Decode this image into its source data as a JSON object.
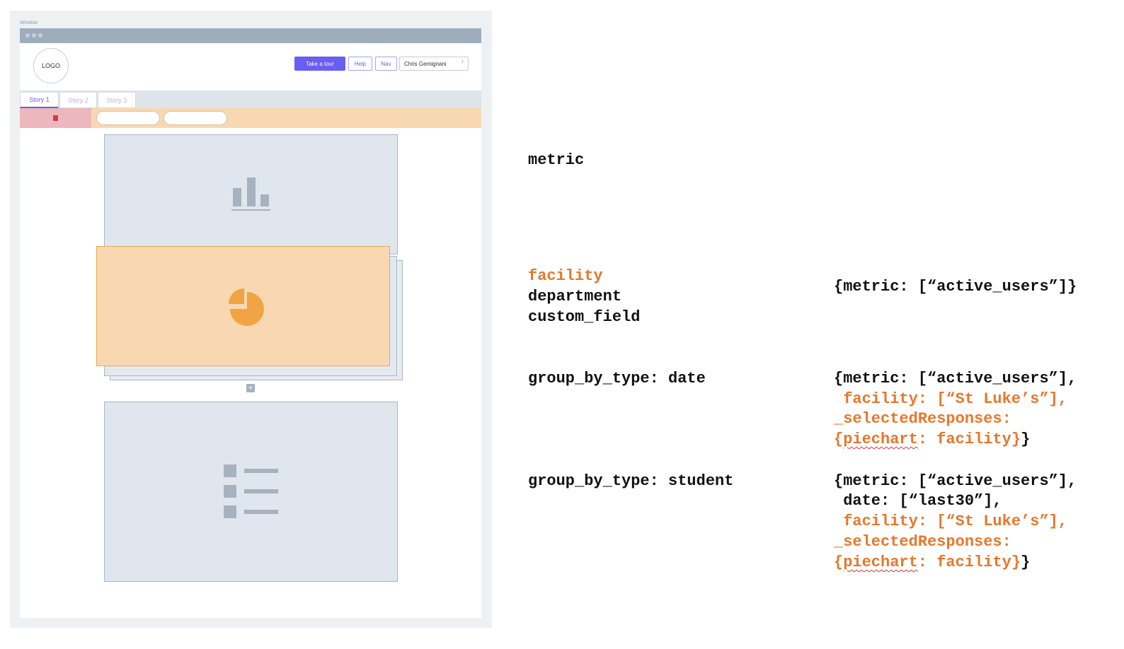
{
  "window": {
    "caption": "Window"
  },
  "header": {
    "logo": "LOGO",
    "take_tour": "Take a tour",
    "help": "Help",
    "nav": "Nav",
    "user": "Chris Gemignani",
    "user_caret": "↕"
  },
  "tabs": [
    {
      "label": "Story 1",
      "active": true
    },
    {
      "label": "Story 2",
      "active": false
    },
    {
      "label": "Story 3",
      "active": false
    }
  ],
  "cards": {
    "bar_icon": "bar-chart-icon",
    "pie_icon": "pie-chart-icon",
    "list_icon": "list-icon",
    "add_icon": "+"
  },
  "colors": {
    "accent": "#6a5df0",
    "highlight": "#f8d8b1",
    "pie": "#f0a443",
    "orange_text": "#e8772a"
  },
  "annotations": {
    "metric": "metric",
    "dims": [
      "facility",
      "department",
      "custom_field"
    ],
    "group_date": "group_by_type: date",
    "group_student": "group_by_type: student",
    "query1": "{metric: [“active_users”]}",
    "query2": {
      "line1": "{metric: [“active_users”],",
      "line2": " facility: [“St Luke’s”],",
      "line3": "_selectedResponses:",
      "line4a": "{",
      "line4b": "piechart",
      "line4c": ": facility}",
      "line4d": "}"
    },
    "query3": {
      "line1": "{metric: [“active_users”],",
      "line2": " date: [“last30”],",
      "line3": " facility: [“St Luke’s”],",
      "line4": "_selectedResponses:",
      "line5a": "{",
      "line5b": "piechart",
      "line5c": ": facility}",
      "line5d": "}"
    }
  }
}
